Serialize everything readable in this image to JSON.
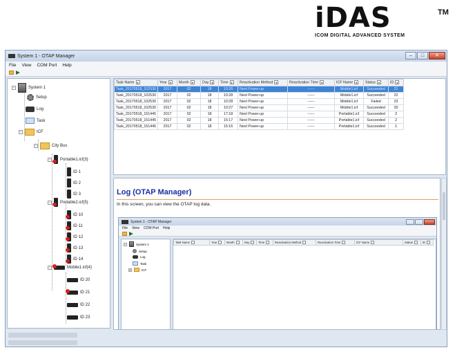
{
  "brand": {
    "logo_text": "iDAS",
    "tm": "TM",
    "tagline": "ICOM DIGITAL ADVANCED SYSTEM"
  },
  "window": {
    "title": "System 1 - OTAP Manager",
    "menu": [
      "File",
      "View",
      "COM Port",
      "Help"
    ]
  },
  "tree": {
    "root": "System 1",
    "setup": "Setup",
    "log": "Log",
    "task": "Task",
    "icf": "ICF",
    "group": "City Bus",
    "portable1": "Portable1.icf(3)",
    "portable1_ids": [
      "ID 1",
      "ID 2",
      "ID 3"
    ],
    "portable2": "Portable2.icf(5)",
    "portable2_ids": [
      "ID 10",
      "ID 11",
      "ID 12",
      "ID 13",
      "ID 14"
    ],
    "mobile1": "Mobile1.icf(4)",
    "mobile1_ids": [
      "ID 20",
      "ID 21",
      "ID 22",
      "ID 23"
    ]
  },
  "task_table": {
    "columns": [
      "Task Name",
      "Year",
      "Month",
      "Day",
      "Time",
      "Reactivation Method",
      "Reactivation Time",
      "ICF Name",
      "Status",
      "ID"
    ],
    "rows": [
      [
        "Task_20170518_102530",
        "2017",
        "02",
        "18",
        "10:28",
        "Next Power-up",
        "------",
        "Mobile1.icf",
        "Succeeded",
        "21"
      ],
      [
        "Task_20170518_102530",
        "2017",
        "02",
        "18",
        "10:28",
        "Next Power-up",
        "------",
        "Mobile1.icf",
        "Succeeded",
        "22"
      ],
      [
        "Task_20170518_102530",
        "2017",
        "02",
        "18",
        "10:28",
        "Next Power-up",
        "------",
        "Mobile1.icf",
        "Failed",
        "23"
      ],
      [
        "Task_20170518_102530",
        "2017",
        "02",
        "18",
        "10:27",
        "Next Power-up",
        "------",
        "Mobile1.icf",
        "Succeeded",
        "20"
      ],
      [
        "Task_20170518_151445",
        "2017",
        "02",
        "18",
        "17:18",
        "Next Power-up",
        "------",
        "Portable1.icf",
        "Succeeded",
        "3"
      ],
      [
        "Task_20170518_151445",
        "2017",
        "02",
        "18",
        "15:17",
        "Next Power-up",
        "------",
        "Portable1.icf",
        "Succeeded",
        "2"
      ],
      [
        "Task_20170518_151445",
        "2017",
        "02",
        "18",
        "15:16",
        "Next Power-up",
        "------",
        "Portable1.icf",
        "Succeeded",
        "1"
      ]
    ],
    "selected_row": 0
  },
  "help": {
    "title": "Log (OTAP Manager)",
    "text": "In this screen, you can view the OTAP log data."
  },
  "mini": {
    "title": "System 1 - OTAP Manager",
    "menu": [
      "File",
      "View",
      "COM Port",
      "Help"
    ],
    "tree": [
      "System 1",
      "Setup",
      "Log",
      "Task",
      "ICF"
    ],
    "columns": [
      "Task Name",
      "Year",
      "Month",
      "Day",
      "Time",
      "Reactivation Method",
      "Reactivation Time",
      "ICF Name",
      "Status",
      "ID"
    ]
  },
  "colors": {
    "accent_red": "#d0101a",
    "selection_blue": "#3d83d6",
    "help_title": "#1b2fa0"
  }
}
